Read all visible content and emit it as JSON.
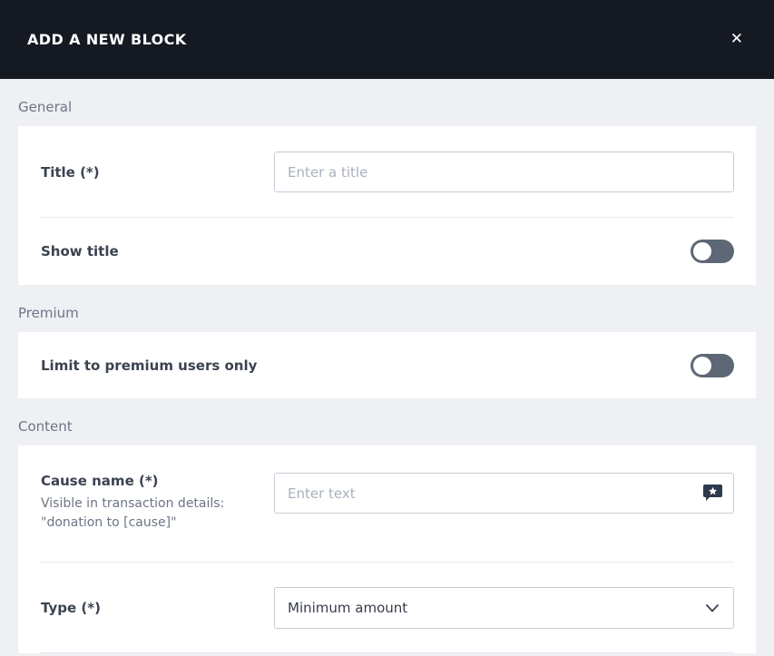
{
  "modal": {
    "title": "ADD A NEW BLOCK",
    "close_label": "✕"
  },
  "sections": {
    "general": {
      "label": "General",
      "title_field": {
        "label": "Title (*)",
        "placeholder": "Enter a title",
        "value": ""
      },
      "show_title": {
        "label": "Show title",
        "state": "off"
      }
    },
    "premium": {
      "label": "Premium",
      "limit_toggle": {
        "label": "Limit to premium users only",
        "state": "off"
      }
    },
    "content": {
      "label": "Content",
      "cause_field": {
        "label": "Cause name (*)",
        "caption_line1": "Visible in transaction details:",
        "caption_line2": "\"donation to [cause]\"",
        "placeholder": "Enter text",
        "value": "",
        "icon": "translate-bubble-icon"
      },
      "type_field": {
        "label": "Type (*)",
        "selected_option": "Minimum amount"
      }
    }
  },
  "colors": {
    "header_bg": "#151922",
    "page_bg": "#eef0f3",
    "card_bg": "#ffffff",
    "toggle_off": "#5d6776",
    "input_border": "#c5cad4",
    "placeholder": "#a9b1bf",
    "label_text": "#3b4350",
    "section_text": "#6d7585",
    "icon_bubble": "#2e3a4d"
  }
}
